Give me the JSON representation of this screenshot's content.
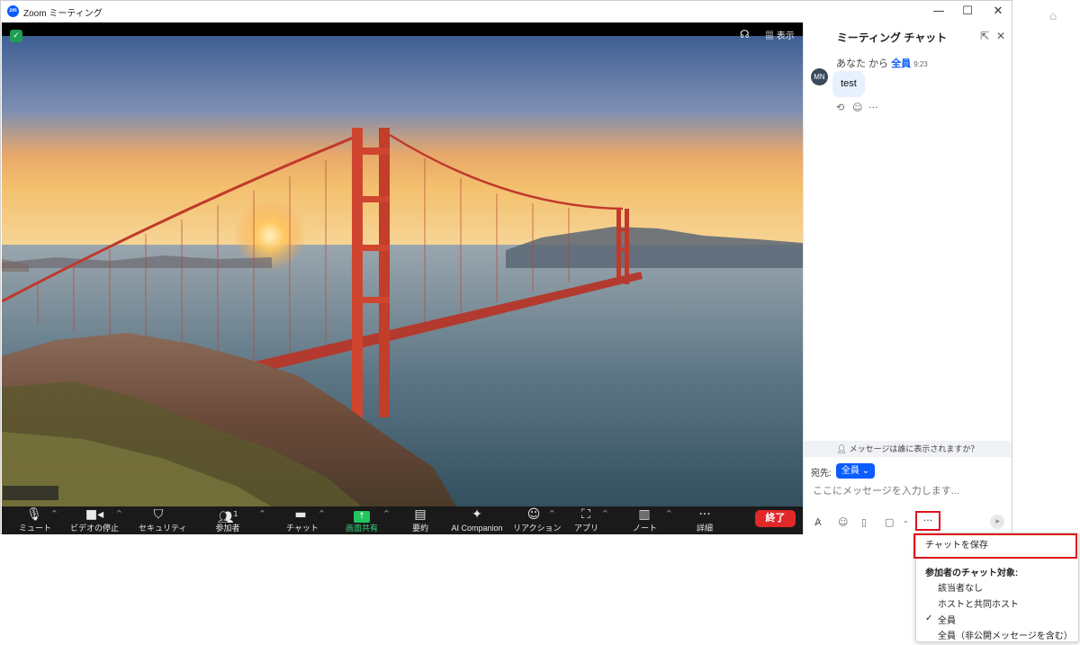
{
  "window": {
    "app_logo": "zm",
    "title": "Zoom ミーティング",
    "controls": {
      "minimize": "—",
      "maximize": "☐",
      "close": "✕"
    }
  },
  "video": {
    "shield_icon": "shield-check-icon",
    "view_label": "表示",
    "view_icon": "grid-icon",
    "stage_icon": "stage-icon"
  },
  "toolbar": {
    "items": [
      {
        "label": "ミュート",
        "icon": "microphone-icon"
      },
      {
        "label": "ビデオの停止",
        "icon": "video-camera-icon"
      },
      {
        "label": "セキュリティ",
        "icon": "shield-icon"
      },
      {
        "label": "参加者",
        "icon": "participants-icon",
        "count": "1"
      },
      {
        "label": "チャット",
        "icon": "chat-bubble-icon"
      },
      {
        "label": "画面共有",
        "icon": "share-screen-icon"
      },
      {
        "label": "要約",
        "icon": "summary-icon"
      },
      {
        "label": "AI Companion",
        "icon": "sparkle-icon"
      },
      {
        "label": "リアクション",
        "icon": "reaction-icon"
      },
      {
        "label": "アプリ",
        "icon": "apps-icon"
      },
      {
        "label": "ノート",
        "icon": "notes-icon"
      },
      {
        "label": "詳細",
        "icon": "more-icon"
      }
    ],
    "end_label": "終了"
  },
  "chat": {
    "title": "ミーティング チャット",
    "message": {
      "avatar": "MN",
      "sender": "あなた",
      "from_word": "から",
      "recipient": "全員",
      "time": "9:23",
      "text": "test"
    },
    "visibility_notice": "メッセージは誰に表示されますか？",
    "to_label": "宛先:",
    "to_value": "全員",
    "input_placeholder": "ここにメッセージを入力します...",
    "more_label": "···"
  },
  "menu": {
    "save_chat": "チャットを保存",
    "header": "参加者のチャット対象:",
    "options": [
      {
        "label": "該当者なし",
        "checked": false
      },
      {
        "label": "ホストと共同ホスト",
        "checked": false
      },
      {
        "label": "全員",
        "checked": true
      },
      {
        "label": "全員（非公開メッセージを含む）",
        "checked": false
      }
    ]
  },
  "colors": {
    "zoom_blue": "#0b5cff",
    "end_red": "#e02828",
    "highlight_red": "#e0111b",
    "share_green": "#23c45e",
    "toolbar_bg": "#1a1a1a"
  }
}
